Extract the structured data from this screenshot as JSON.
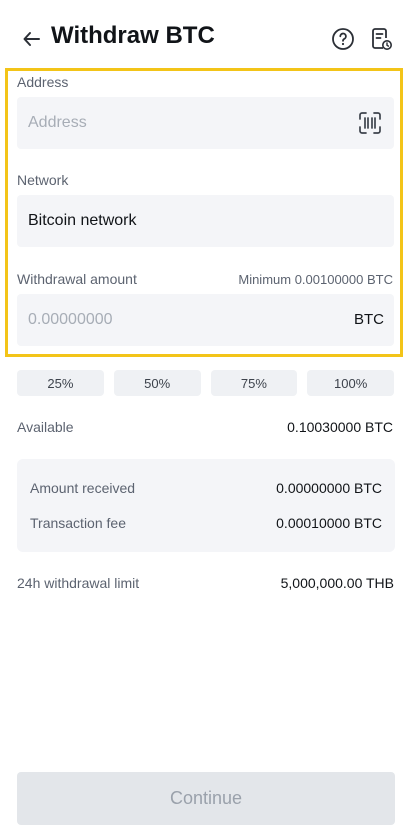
{
  "header": {
    "title": "Withdraw BTC"
  },
  "address": {
    "label": "Address",
    "placeholder": "Address"
  },
  "network": {
    "label": "Network",
    "value": "Bitcoin network"
  },
  "amount": {
    "label": "Withdrawal amount",
    "minimum": "Minimum 0.00100000 BTC",
    "placeholder": "0.00000000",
    "unit": "BTC"
  },
  "percent_buttons": [
    "25%",
    "50%",
    "75%",
    "100%"
  ],
  "available": {
    "label": "Available",
    "value": "0.10030000 BTC"
  },
  "summary": {
    "amount_received_label": "Amount received",
    "amount_received_value": "0.00000000 BTC",
    "fee_label": "Transaction fee",
    "fee_value": "0.00010000 BTC"
  },
  "limit": {
    "label": "24h withdrawal limit",
    "value": "5,000,000.00 THB"
  },
  "continue_label": "Continue",
  "colors": {
    "highlight": "#f3c418",
    "field_bg": "#f4f5f8",
    "disabled_button": "#e3e6ea"
  },
  "icons": [
    "back-arrow-icon",
    "help-icon",
    "history-icon",
    "scan-icon"
  ]
}
